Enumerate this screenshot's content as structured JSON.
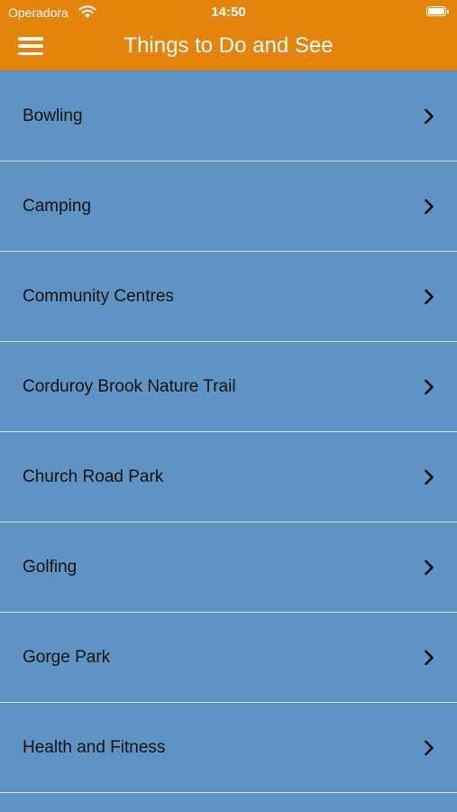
{
  "status_bar": {
    "carrier": "Operadora",
    "time": "14:50",
    "wifi_icon": "wifi-icon",
    "battery_icon": "battery-icon"
  },
  "nav": {
    "title": "Things to Do and See",
    "menu_icon": "hamburger-menu-icon",
    "color": "#e5840a"
  },
  "colors": {
    "list_background": "#5f93c3",
    "separator": "#d4e2ef"
  },
  "items": [
    {
      "label": "Bowling",
      "icon": "chevron-right-icon"
    },
    {
      "label": "Camping",
      "icon": "chevron-right-icon"
    },
    {
      "label": "Community Centres",
      "icon": "chevron-right-icon"
    },
    {
      "label": "Corduroy Brook Nature Trail",
      "icon": "chevron-right-icon"
    },
    {
      "label": "Church Road Park",
      "icon": "chevron-right-icon"
    },
    {
      "label": "Golfing",
      "icon": "chevron-right-icon"
    },
    {
      "label": "Gorge Park",
      "icon": "chevron-right-icon"
    },
    {
      "label": "Health and Fitness",
      "icon": "chevron-right-icon"
    }
  ]
}
